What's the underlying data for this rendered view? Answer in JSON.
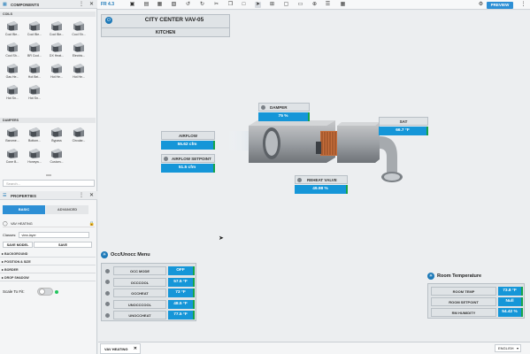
{
  "topbar": {
    "version": "FR 4.3",
    "preview": "PREVIEW"
  },
  "components": {
    "title": "COMPONENTS",
    "coils_section": "COILS",
    "coils": [
      "Cool Ble...",
      "Cool Ble...",
      "Cool Ble...",
      "Cool Sh...",
      "Cool Sh...",
      "BR Cool...",
      "DX Heat...",
      "Electric...",
      "Gas He...",
      "Hot Bei...",
      "Hot He...",
      "Hot He...",
      "Hot Sn...",
      "Hot Sn..."
    ],
    "dampers_section": "DAMPERS",
    "dampers": [
      "Barome...",
      "Bottom...",
      "Bypass",
      "Circular...",
      "Cone B...",
      "Honeyw...",
      "Custom..."
    ],
    "search_placeholder": "Search..."
  },
  "properties": {
    "title": "PROPERTIES",
    "tab_basic": "BASIC",
    "tab_advanced": "ADVANCED",
    "object_name": "VAV HEATING",
    "classes_label": "Classes:",
    "classes_value": "view-layer",
    "save_model": "SAVE MODEL",
    "save": "SAVE",
    "sections": [
      "BACKGROUND",
      "POSITION & SIZE",
      "BORDER",
      "DROP SHADOW"
    ],
    "scale_label": "Scale To Fit:"
  },
  "header": {
    "title": "CITY CENTER VAV-05",
    "subtitle": "KITCHEN"
  },
  "points": {
    "damper": {
      "label": "DAMPER",
      "value": "75 %"
    },
    "sat": {
      "label": "SAT",
      "value": "66.7 °F"
    },
    "airflow": {
      "label": "AIRFLOW",
      "value": "55.62 cfm"
    },
    "airflow_sp": {
      "label": "AIRFLOW SETPOINT",
      "value": "51.5 cfm"
    },
    "reheat": {
      "label": "REHEAT VALVE",
      "value": "49.98 %"
    }
  },
  "occ": {
    "title": "Occ/Unocc Menu",
    "rows": [
      {
        "label": "OCC MODE",
        "value": "OFF"
      },
      {
        "label": "OCCCOOL",
        "value": "57.5 °F"
      },
      {
        "label": "OCCHEAT",
        "value": "73 °F"
      },
      {
        "label": "UNOCCCOOL",
        "value": "48.5 °F"
      },
      {
        "label": "UNOCCHEAT",
        "value": "77.5 °F"
      }
    ]
  },
  "room": {
    "title": "Room Temperature",
    "rows": [
      {
        "label": "ROOM TEMP",
        "value": "73.8 °F"
      },
      {
        "label": "ROOM SETPOINT",
        "value": "Null"
      },
      {
        "label": "RM HUMIDITY",
        "value": "54.42 %"
      }
    ]
  },
  "status": {
    "tab": "VAV HEATING",
    "language": "ENGLISH"
  }
}
